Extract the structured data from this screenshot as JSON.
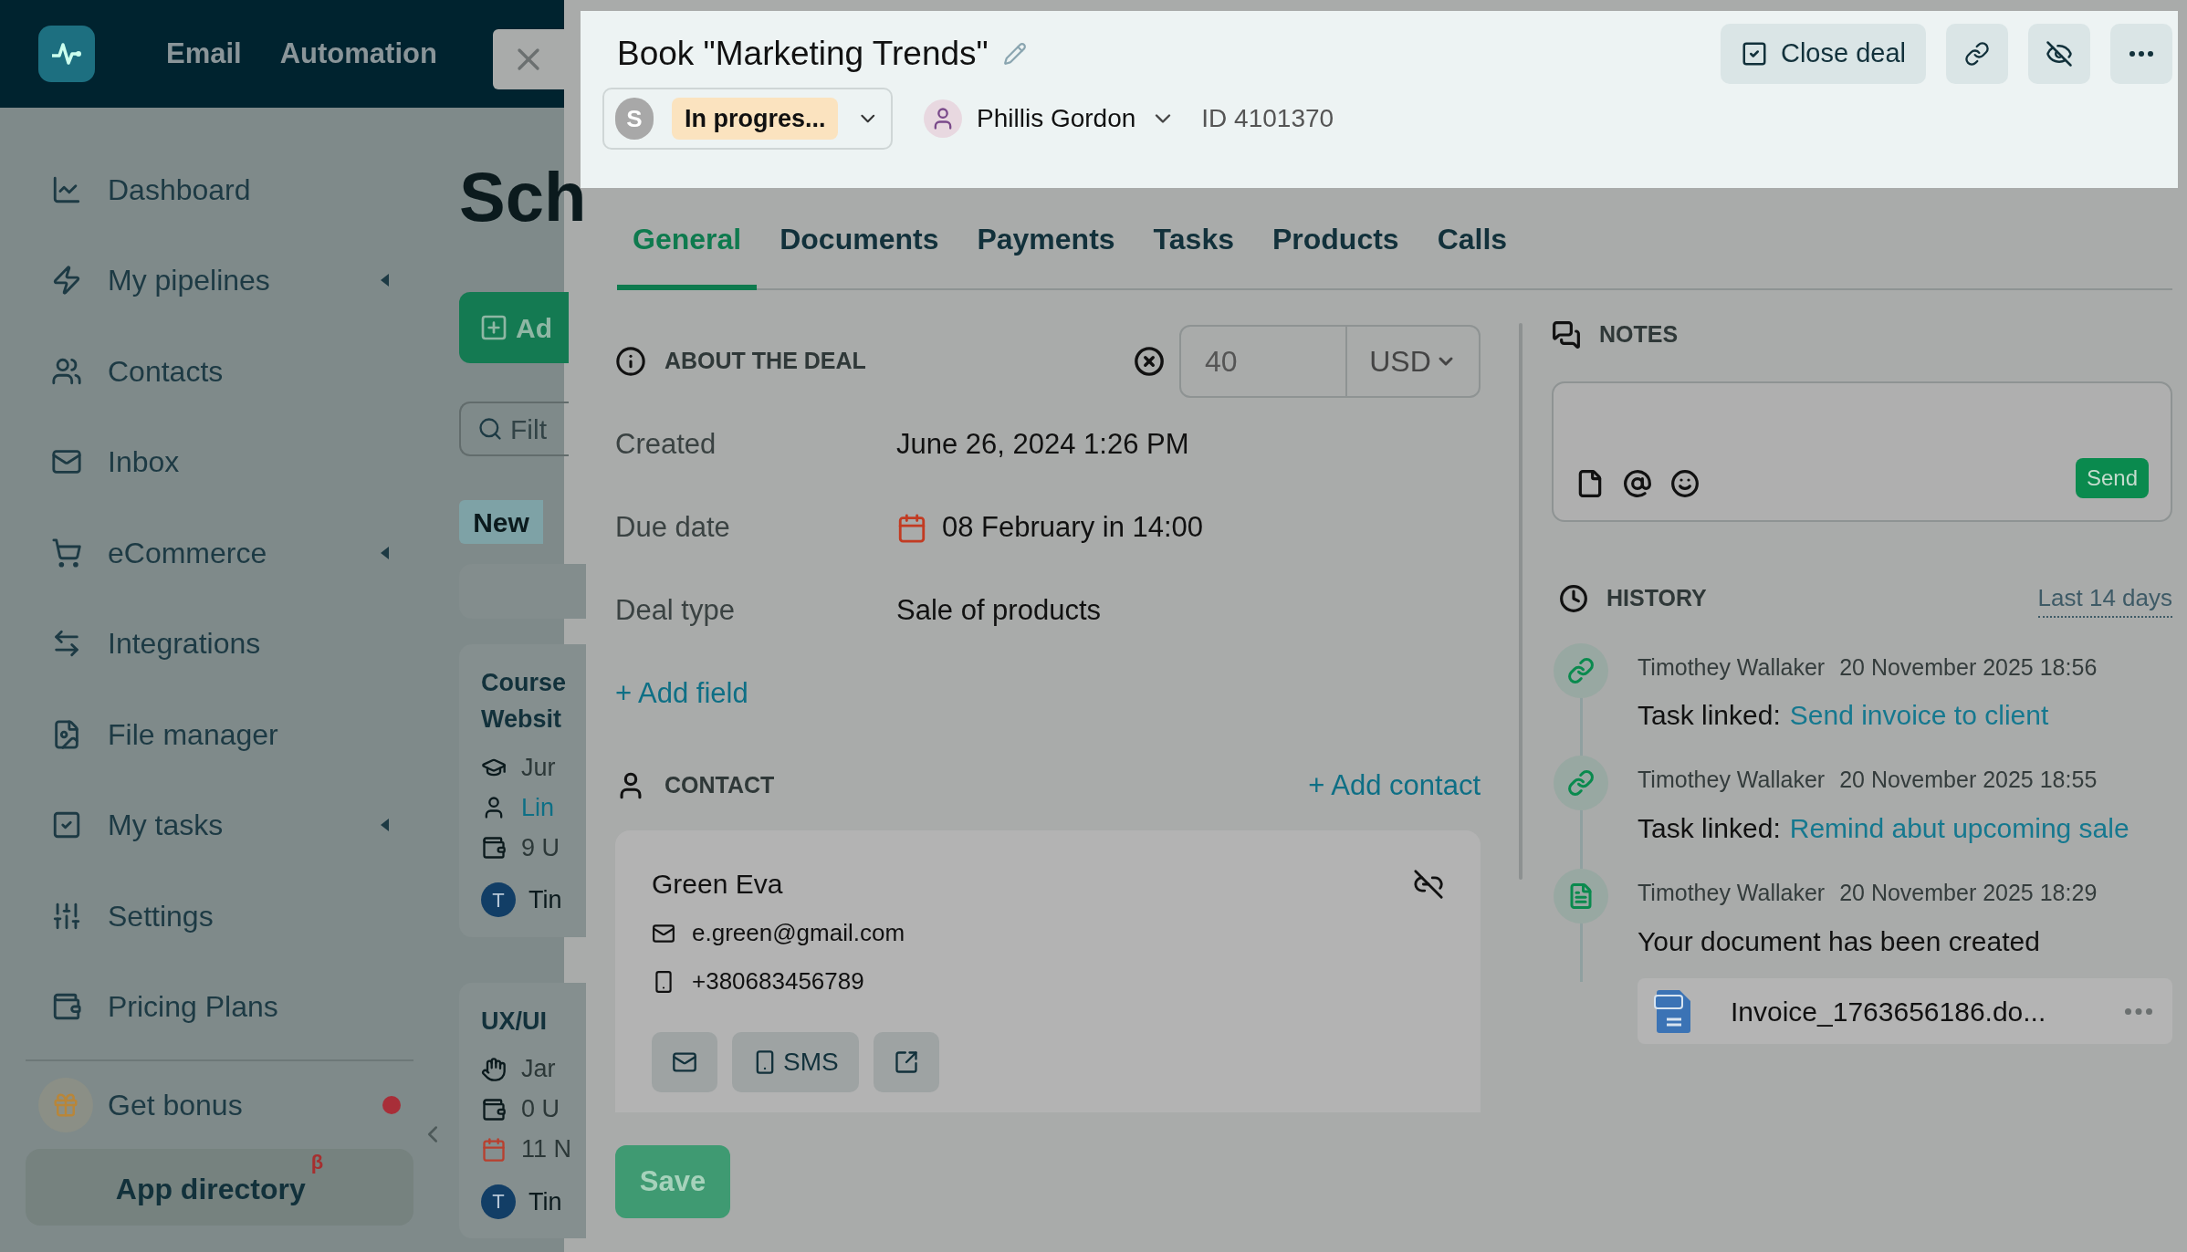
{
  "topbar": {
    "nav": [
      "Email",
      "Automation"
    ]
  },
  "sidebar": {
    "items": [
      {
        "label": "Dashboard",
        "expandable": false
      },
      {
        "label": "My pipelines",
        "expandable": true
      },
      {
        "label": "Contacts",
        "expandable": false
      },
      {
        "label": "Inbox",
        "expandable": false
      },
      {
        "label": "eCommerce",
        "expandable": true
      },
      {
        "label": "Integrations",
        "expandable": false
      },
      {
        "label": "File manager",
        "expandable": false
      },
      {
        "label": "My tasks",
        "expandable": true
      },
      {
        "label": "Settings",
        "expandable": false
      },
      {
        "label": "Pricing Plans",
        "expandable": false
      }
    ],
    "bonus": {
      "label": "Get bonus",
      "notification": true
    },
    "app_directory": {
      "label": "App directory",
      "badge": "β"
    }
  },
  "background_page": {
    "title": "Sch",
    "add_button": "Ad",
    "filter_placeholder": "Filt",
    "column_badge": "New",
    "cards": [
      {
        "title": [
          "Course",
          "Websit"
        ],
        "rows": [
          "Jur",
          "Lin",
          "9 U"
        ],
        "avatar": "T",
        "assignee": "Tin"
      },
      {
        "title": [
          "UX/UI"
        ],
        "rows": [
          "Jar",
          "0 U",
          "11 N"
        ],
        "avatar": "T",
        "assignee": "Tin"
      }
    ]
  },
  "deal": {
    "title": "Book \"Marketing Trends\"",
    "status": {
      "avatar": "S",
      "label": "In progres..."
    },
    "owner": "Phillis Gordon",
    "id": "ID 4101370",
    "close_button": "Close deal",
    "tabs": [
      {
        "label": "General",
        "selected": true
      },
      {
        "label": "Documents",
        "selected": false
      },
      {
        "label": "Payments",
        "selected": false
      },
      {
        "label": "Tasks",
        "selected": false
      },
      {
        "label": "Products",
        "selected": false
      },
      {
        "label": "Calls",
        "selected": false
      }
    ],
    "about": {
      "heading": "ABOUT THE DEAL",
      "amount": "40",
      "currency": "USD",
      "fields": [
        {
          "label": "Created",
          "value": "June 26, 2024 1:26 PM",
          "kind": "text"
        },
        {
          "label": "Due date",
          "value": "08 February in 14:00",
          "kind": "date"
        },
        {
          "label": "Deal type",
          "value": "Sale of products",
          "kind": "text"
        }
      ],
      "add_field": "+ Add field"
    },
    "contact": {
      "heading": "CONTACT",
      "add": "+ Add contact",
      "name": "Green Eva",
      "email": "e.green@gmail.com",
      "phone": "+380683456789",
      "sms": "SMS"
    },
    "save": "Save",
    "notes": {
      "heading": "NOTES",
      "send": "Send"
    },
    "history": {
      "heading": "HISTORY",
      "filter": "Last 14 days",
      "entries": [
        {
          "kind": "task_link",
          "author": "Timothey Wallaker",
          "date": "20 November 2025 18:56",
          "text": "Task linked:",
          "link": "Send invoice to client"
        },
        {
          "kind": "task_link",
          "author": "Timothey Wallaker",
          "date": "20 November 2025 18:55",
          "text": "Task linked:",
          "link": "Remind abut upcoming sale"
        },
        {
          "kind": "document",
          "author": "Timothey Wallaker",
          "date": "20 November 2025 18:29",
          "text": "Your document has been created",
          "file": "Invoice_1763656186.do..."
        }
      ]
    }
  }
}
